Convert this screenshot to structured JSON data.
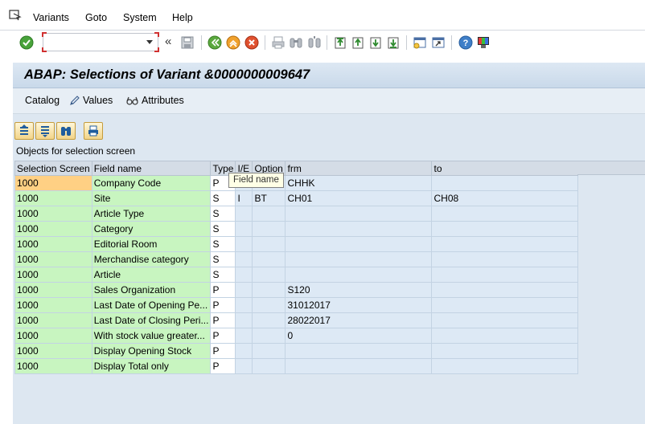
{
  "menu": {
    "items": [
      "Variants",
      "Goto",
      "System",
      "Help"
    ]
  },
  "toolbar": {
    "command_value": "",
    "icons": [
      "enter-icon",
      "save-icon",
      "back-icon",
      "exit-icon",
      "cancel-icon",
      "print-icon",
      "find-icon",
      "find-next-icon",
      "first-page-icon",
      "previous-page-icon",
      "next-page-icon",
      "last-page-icon",
      "create-session-icon",
      "shortcut-icon",
      "help-icon",
      "layout-icon"
    ]
  },
  "title": "ABAP: Selections of Variant &0000000009647",
  "app_toolbar": {
    "catalog": "Catalog",
    "values": "Values",
    "attributes": "Attributes"
  },
  "grid": {
    "title": "Objects for selection screen",
    "columns": [
      "Selection Screen",
      "Field name",
      "Type",
      "I/E",
      "Option",
      "frm",
      "to"
    ],
    "rows": [
      {
        "screen": "1000",
        "field": "Company Code",
        "type": "P",
        "ie": "",
        "option": "",
        "frm": "CHHK",
        "to": ""
      },
      {
        "screen": "1000",
        "field": "Site",
        "type": "S",
        "ie": "I",
        "option": "BT",
        "frm": "CH01",
        "to": "CH08"
      },
      {
        "screen": "1000",
        "field": "Article Type",
        "type": "S",
        "ie": "",
        "option": "",
        "frm": "",
        "to": ""
      },
      {
        "screen": "1000",
        "field": "Category",
        "type": "S",
        "ie": "",
        "option": "",
        "frm": "",
        "to": ""
      },
      {
        "screen": "1000",
        "field": "Editorial Room",
        "type": "S",
        "ie": "",
        "option": "",
        "frm": "",
        "to": ""
      },
      {
        "screen": "1000",
        "field": "Merchandise category",
        "type": "S",
        "ie": "",
        "option": "",
        "frm": "",
        "to": ""
      },
      {
        "screen": "1000",
        "field": "Article",
        "type": "S",
        "ie": "",
        "option": "",
        "frm": "",
        "to": ""
      },
      {
        "screen": "1000",
        "field": "Sales Organization",
        "type": "P",
        "ie": "",
        "option": "",
        "frm": "S120",
        "to": ""
      },
      {
        "screen": "1000",
        "field": "Last Date of Opening Pe...",
        "type": "P",
        "ie": "",
        "option": "",
        "frm": "31012017",
        "to": ""
      },
      {
        "screen": "1000",
        "field": "Last Date of Closing Peri...",
        "type": "P",
        "ie": "",
        "option": "",
        "frm": "28022017",
        "to": ""
      },
      {
        "screen": "1000",
        "field": "With stock value greater...",
        "type": "P",
        "ie": "",
        "option": "",
        "frm": "0",
        "to": ""
      },
      {
        "screen": "1000",
        "field": "Display Opening Stock",
        "type": "P",
        "ie": "",
        "option": "",
        "frm": "",
        "to": ""
      },
      {
        "screen": "1000",
        "field": "Display Total only",
        "type": "P",
        "ie": "",
        "option": "",
        "frm": "",
        "to": ""
      }
    ]
  },
  "tooltip": "Field name",
  "colors": {
    "title_bg": "#c9d9ea",
    "content_bg": "#dde7f1",
    "field_green": "#c8f5c0",
    "active_cell": "#ffd084"
  }
}
